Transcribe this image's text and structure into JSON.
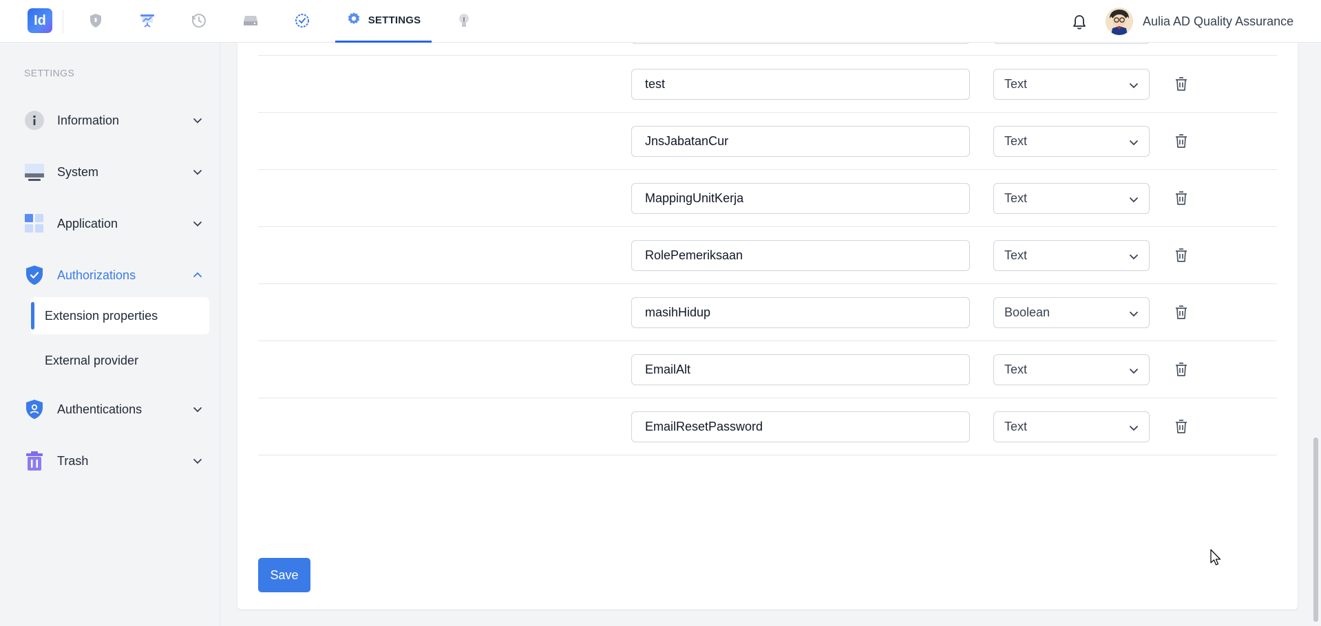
{
  "app": {
    "logo_text": "Id",
    "active_tab_label": "SETTINGS",
    "user_name": "Aulia AD Quality Assurance",
    "accent_color": "#3b7be8"
  },
  "nav_icons": [
    "shield-icon",
    "presentation-icon",
    "history-icon",
    "drive-icon",
    "check-badge-icon",
    "gear-icon",
    "bulb-icon",
    "bell-icon"
  ],
  "sidebar": {
    "section_title": "SETTINGS",
    "items": [
      {
        "label": "Information",
        "icon": "info-icon",
        "expanded": false
      },
      {
        "label": "System",
        "icon": "monitor-icon",
        "expanded": false
      },
      {
        "label": "Application",
        "icon": "grid-icon",
        "expanded": false
      },
      {
        "label": "Authorizations",
        "icon": "shield-check-icon",
        "expanded": true
      },
      {
        "label": "Authentications",
        "icon": "shield-user-icon",
        "expanded": false
      },
      {
        "label": "Trash",
        "icon": "trash-icon",
        "expanded": false
      }
    ],
    "sub_items": [
      {
        "label": "Extension properties",
        "active": true
      },
      {
        "label": "External provider",
        "active": false
      }
    ]
  },
  "properties": [
    {
      "name": "test",
      "type": "Text"
    },
    {
      "name": "JnsJabatanCur",
      "type": "Text"
    },
    {
      "name": "MappingUnitKerja",
      "type": "Text"
    },
    {
      "name": "RolePemeriksaan",
      "type": "Text"
    },
    {
      "name": "masihHidup",
      "type": "Boolean"
    },
    {
      "name": "EmailAlt",
      "type": "Text"
    },
    {
      "name": "EmailResetPassword",
      "type": "Text"
    }
  ],
  "actions": {
    "save_label": "Save"
  }
}
